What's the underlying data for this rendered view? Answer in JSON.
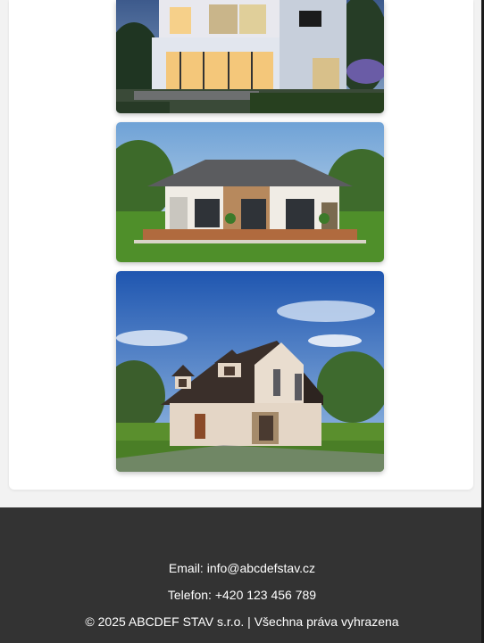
{
  "gallery": {
    "images": [
      {
        "alt": "modern-two-storey-house"
      },
      {
        "alt": "single-storey-bungalow"
      },
      {
        "alt": "family-house-with-dormers"
      }
    ]
  },
  "footer": {
    "email": "Email: info@abcdefstav.cz",
    "phone": "Telefon: +420 123 456 789",
    "copyright": "© 2025 ABCDEF STAV s.r.o. | Všechna práva vyhrazena"
  },
  "colors": {
    "footer_bg": "#333333",
    "page_bg": "#f2f2f2",
    "card_bg": "#ffffff"
  }
}
